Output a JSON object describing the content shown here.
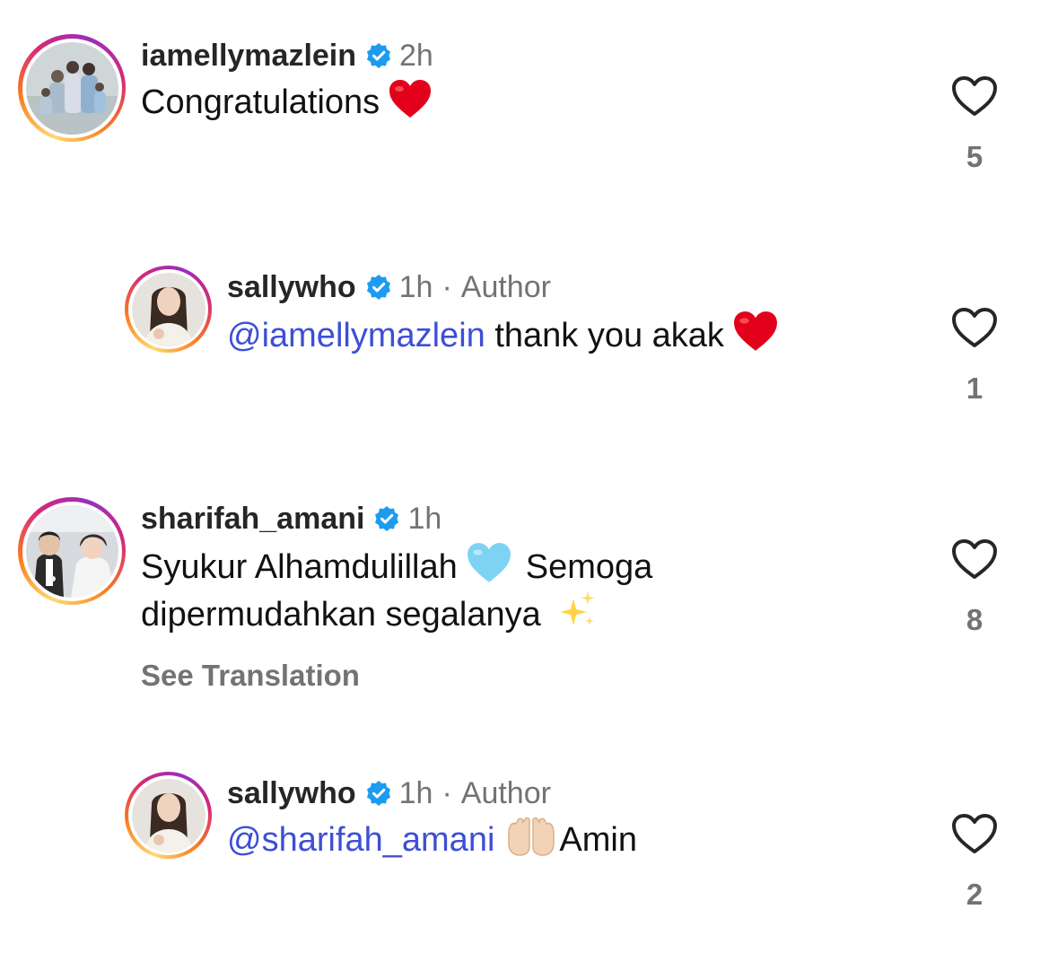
{
  "comments": [
    {
      "username": "iamellymazlein",
      "time": "2h",
      "author_tag": "",
      "mention": "",
      "text": "Congratulations",
      "emoji": "red-heart",
      "likes": "5",
      "see_translation": ""
    },
    {
      "username": "sallywho",
      "time": "1h",
      "author_tag": "Author",
      "mention": "@iamellymazlein",
      "text": " thank you akak",
      "emoji": "red-heart",
      "likes": "1",
      "see_translation": ""
    },
    {
      "username": "sharifah_amani",
      "time": "1h",
      "author_tag": "",
      "mention": "",
      "text_line1": "Syukur Alhamdulillah",
      "text_line1_b": "Semoga",
      "text_line2": "dipermudahkan segalanya",
      "emoji": "light-blue-heart",
      "emoji2": "sparkles",
      "likes": "8",
      "see_translation": "See Translation"
    },
    {
      "username": "sallywho",
      "time": "1h",
      "author_tag": "Author",
      "mention": "@sharifah_amani",
      "text": "Amin",
      "emoji": "palms-up",
      "likes": "2",
      "see_translation": ""
    }
  ],
  "separator": "·",
  "colors": {
    "mention": "#3d4fd6",
    "verified": "#1d9bf0",
    "muted": "#737373"
  }
}
